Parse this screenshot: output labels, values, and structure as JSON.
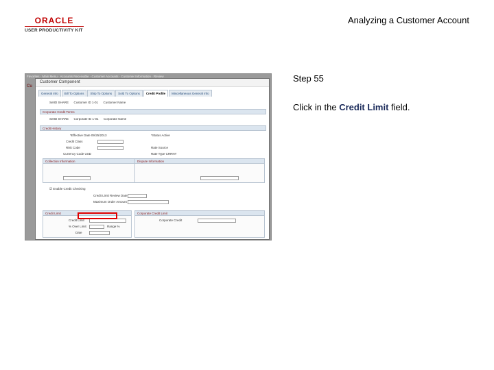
{
  "logo": {
    "brand": "ORACLE",
    "product": "USER PRODUCTIVITY KIT"
  },
  "header": {
    "title": "Analyzing a Customer Account"
  },
  "step": {
    "label": "Step 55"
  },
  "instruction": {
    "prefix": "Click in the ",
    "field": "Credit Limit",
    "suffix": " field."
  },
  "screenshot": {
    "window_title": "Customer Component",
    "tabs": [
      "General Info",
      "Bill To Options",
      "Ship To Options",
      "Sold To Options",
      "Credit Profile",
      "Miscellaneous General Info"
    ],
    "active_tab": "Credit Profile",
    "highlight_color": "#e00000"
  }
}
